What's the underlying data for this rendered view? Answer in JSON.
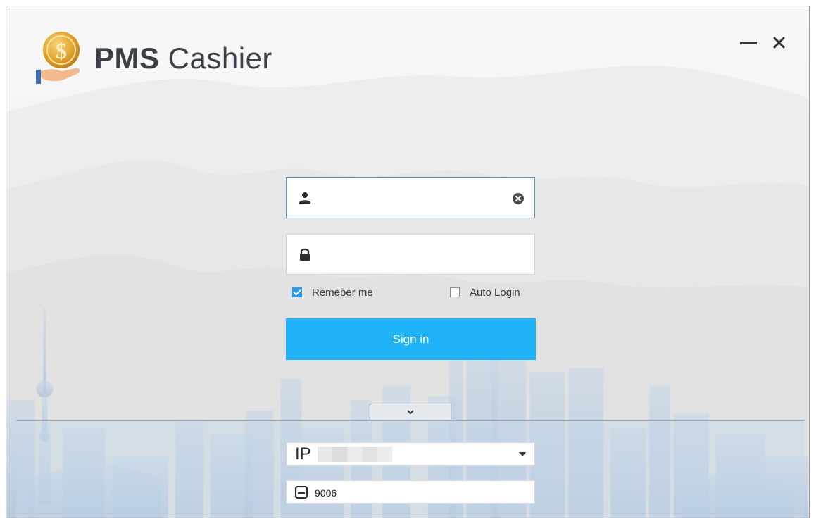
{
  "app": {
    "title_bold": "PMS",
    "title_rest": " Cashier"
  },
  "window_controls": {
    "minimize_icon": "minimize-icon",
    "close_icon": "close-icon"
  },
  "login": {
    "username_value": "",
    "username_icon": "user-icon",
    "clear_icon": "clear-circle-icon",
    "password_value": "",
    "password_icon": "lock-icon",
    "remember_label": "Remeber me",
    "remember_checked": true,
    "auto_login_label": "Auto Login",
    "auto_login_checked": false,
    "signin_label": "Sign in"
  },
  "server": {
    "expand_icon": "chevron-down-icon",
    "ip_label": "IP",
    "ip_dropdown_icon": "caret-down-icon",
    "port_icon": "port-icon",
    "port_value": "9006"
  },
  "colors": {
    "accent": "#1fb2f6",
    "checkbox": "#2b9be3",
    "focus_border": "#5f8fc7"
  }
}
